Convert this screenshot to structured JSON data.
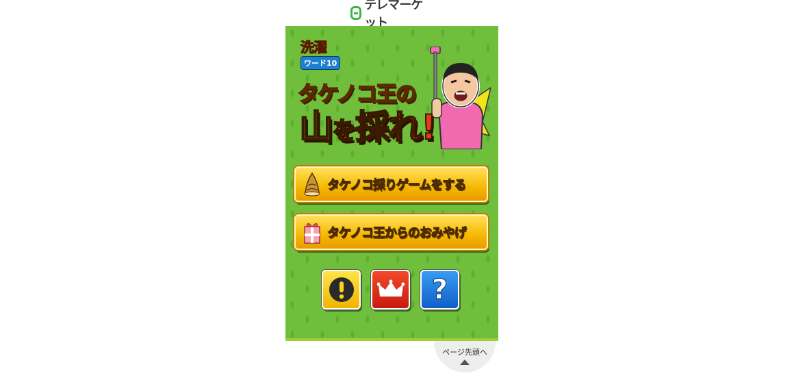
{
  "header": {
    "logo_text": "テレマーケット"
  },
  "game": {
    "show_logo_top": "洗濯",
    "show_logo_bottom": "ワード10",
    "title_line1": "タケノコ王の",
    "title_line2_a": "山",
    "title_line2_b": "を",
    "title_line2_c": "採れ!",
    "buttons": {
      "play_label": "タケノコ採りゲームをする",
      "gift_label": "タケノコ王からのおみやげ"
    }
  },
  "page_top": {
    "label": "ページ先頭へ"
  },
  "colors": {
    "grass": "#6fbe3c",
    "button_yellow": "#f5b800",
    "info_yellow": "#ffe44a",
    "rank_red": "#e2301a",
    "help_blue": "#1e7ee0"
  },
  "icons": {
    "play": "bamboo-shoot-icon",
    "gift": "gift-box-icon",
    "info": "exclamation-icon",
    "rank": "crown-icon",
    "help": "question-icon"
  }
}
